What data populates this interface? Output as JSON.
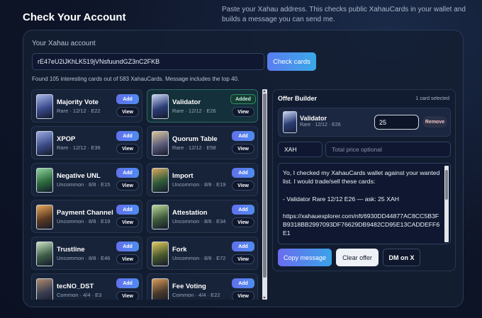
{
  "header": {
    "title": "Check Your Account",
    "intro": "Paste your Xahau address. This checks public XahauCards in your wallet and builds a message you can send me."
  },
  "account": {
    "label": "Your Xahau account",
    "value": "rE47eU2iJKhLK519jVNsfuundGZ3nC2FKB",
    "check_button": "Check cards",
    "found_text": "Found 105 interesting cards out of 583 XahauCards. Message includes the top 40."
  },
  "cards": [
    {
      "name": "Majority Vote",
      "meta": "Rare · 12/12 · E22",
      "add": "Add",
      "view": "View",
      "added": false,
      "art": [
        "#3a4a8c",
        "#a7b6e8"
      ]
    },
    {
      "name": "Validator",
      "meta": "Rare · 12/12 · E26",
      "add": "Added",
      "view": "View",
      "added": true,
      "art": [
        "#2b3c74",
        "#c9d3f2"
      ]
    },
    {
      "name": "XPOP",
      "meta": "Rare · 12/12 · E36",
      "add": "Add",
      "view": "View",
      "added": false,
      "art": [
        "#3b4c86",
        "#9aa9e0"
      ]
    },
    {
      "name": "Quorum Table",
      "meta": "Rare · 12/12 · E58",
      "add": "Add",
      "view": "View",
      "added": false,
      "art": [
        "#5b5a7a",
        "#d8c59a"
      ]
    },
    {
      "name": "Negative UNL",
      "meta": "Uncommon · 8/8 · E15",
      "add": "Add",
      "view": "View",
      "added": false,
      "art": [
        "#2c6a3e",
        "#8fd29b"
      ]
    },
    {
      "name": "Import",
      "meta": "Uncommon · 8/8 · E19",
      "add": "Add",
      "view": "View",
      "added": false,
      "art": [
        "#2f5c3a",
        "#d9a65a"
      ]
    },
    {
      "name": "Payment Channel",
      "meta": "Uncommon · 8/8 · E19",
      "add": "Add",
      "view": "View",
      "added": false,
      "art": [
        "#5c3a22",
        "#e8a75a"
      ]
    },
    {
      "name": "Attestation",
      "meta": "Uncommon · 8/8 · E34",
      "add": "Add",
      "view": "View",
      "added": false,
      "art": [
        "#3f5a3a",
        "#b9d89a"
      ]
    },
    {
      "name": "Trustline",
      "meta": "Uncommon · 8/8 · E46",
      "add": "Add",
      "view": "View",
      "added": false,
      "art": [
        "#3d5c48",
        "#c8e0c0"
      ]
    },
    {
      "name": "Fork",
      "meta": "Uncommon · 8/8 · E72",
      "add": "Add",
      "view": "View",
      "added": false,
      "art": [
        "#4a5a2c",
        "#e0c860"
      ]
    },
    {
      "name": "tecNO_DST",
      "meta": "Common · 4/4 · E3",
      "add": "Add",
      "view": "View",
      "added": false,
      "art": [
        "#3a3f52",
        "#b08a6a"
      ]
    },
    {
      "name": "Fee Voting",
      "meta": "Common · 4/4 · E22",
      "add": "Add",
      "view": "View",
      "added": false,
      "art": [
        "#4a3a2a",
        "#d89a5a"
      ]
    }
  ],
  "offer": {
    "title": "Offer Builder",
    "count": "1 card selected",
    "selected": {
      "name": "Validator",
      "meta": "Rare · 12/12 · E26",
      "price": "25",
      "remove": "Remove"
    },
    "currency": "XAH",
    "total_placeholder": "Total price optional",
    "message": "Yo, I checked my XahauCards wallet against your wanted list. I would trade/sell these cards:\n\n- Validator Rare 12/12 E26 — ask: 25 XAH\n\nhttps://xahauexplorer.com/nft/6930DD44877AC8CC5B3FB9318BB2997093DF76629DB9482CD95E13CADDEFF6E1",
    "copy_button": "Copy message",
    "clear_button": "Clear offer",
    "dm_button": "DM on X"
  }
}
